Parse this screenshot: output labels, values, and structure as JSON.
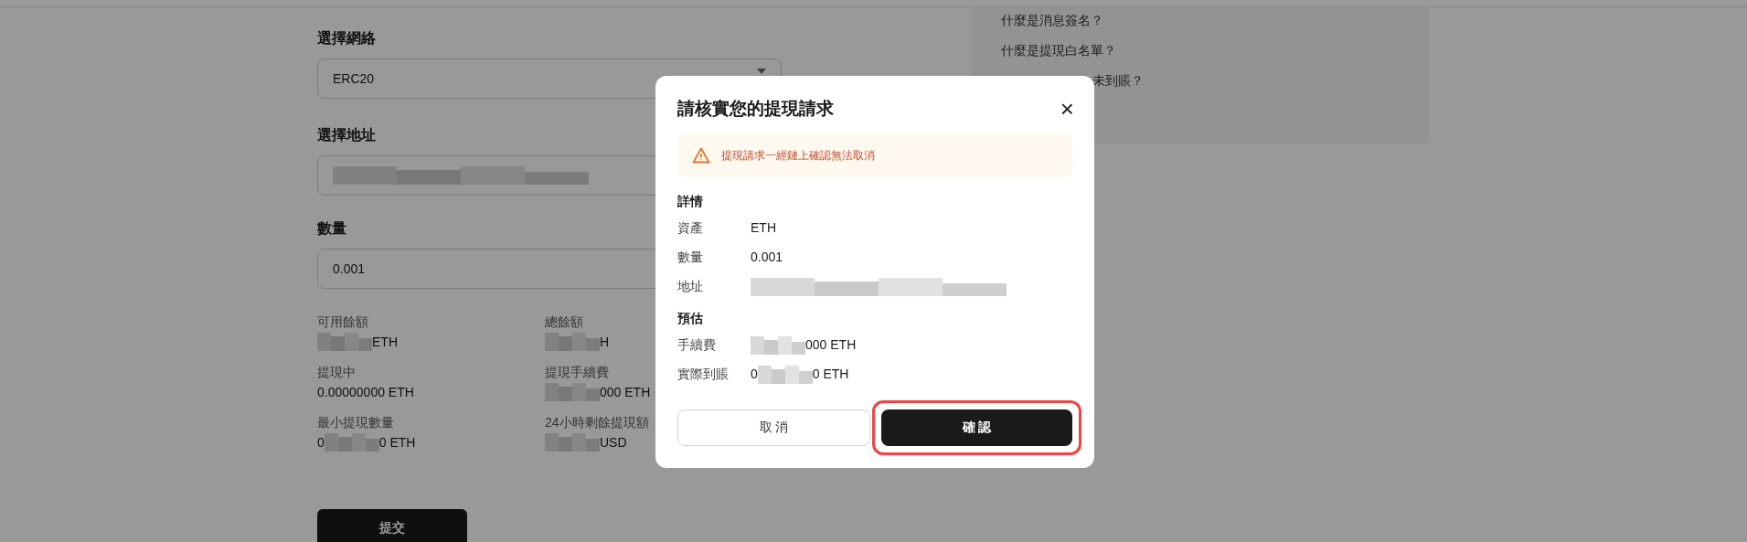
{
  "form": {
    "network_label": "選擇網絡",
    "network_value": "ERC20",
    "address_label": "選擇地址",
    "address_redacted": true,
    "amount_label": "數量",
    "amount_value": "0.001",
    "stats": [
      {
        "label": "可用餘額",
        "value_end": "ETH",
        "redacted": true
      },
      {
        "label": "總餘額",
        "value_end": "H",
        "redacted": true
      },
      {
        "label": "提現中",
        "value_start": "0.00000000 ETH"
      },
      {
        "label": "提現手續費",
        "value_end": "000 ETH",
        "redacted": true
      },
      {
        "label": "最小提現數量",
        "value_start": "0",
        "value_end": "0 ETH",
        "redacted": true
      },
      {
        "label": "24小時剩餘提現額",
        "value_end": "USD",
        "redacted": true
      }
    ],
    "submit": "提交"
  },
  "help": {
    "items": [
      {
        "text": "什麼是消息簽名？",
        "offset": false
      },
      {
        "text": "什麼是提現白名單？",
        "offset": false
      },
      {
        "text": "未到賬？",
        "offset": true
      }
    ]
  },
  "modal": {
    "title": "請核實您的提現請求",
    "close": "×",
    "warning": "提現請求一經鏈上確認無法取消",
    "sections": [
      {
        "heading": "詳情",
        "rows": [
          {
            "label": "資產",
            "value_start": "ETH"
          },
          {
            "label": "數量",
            "value_start": "0.001"
          },
          {
            "label": "地址",
            "redacted": true
          }
        ]
      },
      {
        "heading": "預估",
        "rows": [
          {
            "label": "手續費",
            "value_end": "000 ETH",
            "redacted": true
          },
          {
            "label": "實際到賬",
            "value_start": "0",
            "value_end": "0 ETH",
            "redacted": true
          }
        ]
      }
    ],
    "cancel": "取 消",
    "confirm": "確 認",
    "confirm_highlighted": true
  }
}
